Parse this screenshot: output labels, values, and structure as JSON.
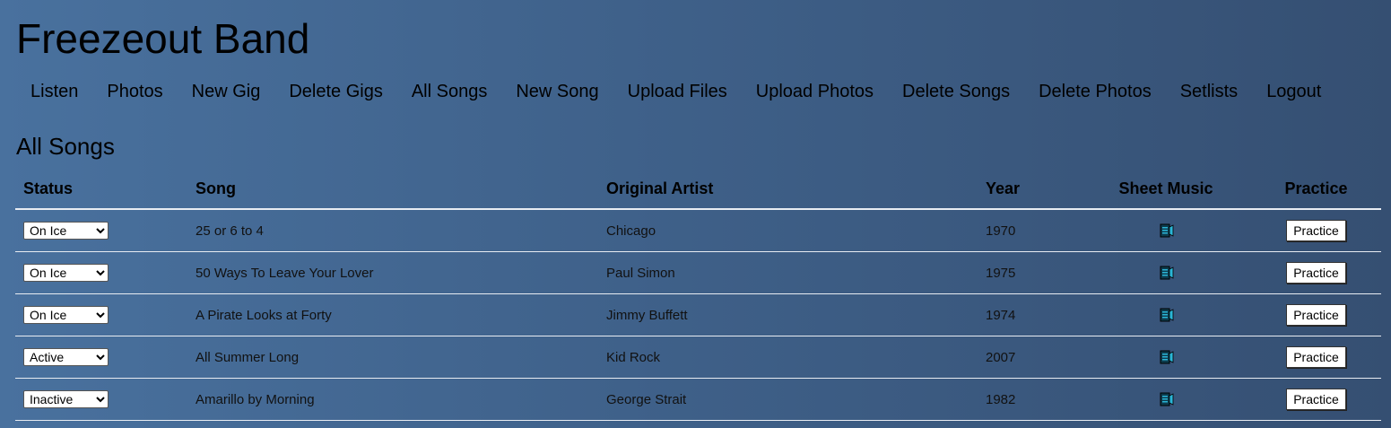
{
  "site": {
    "title": "Freezeout Band"
  },
  "nav": {
    "items": [
      {
        "label": "Listen",
        "name": "nav-listen"
      },
      {
        "label": "Photos",
        "name": "nav-photos"
      },
      {
        "label": "New Gig",
        "name": "nav-new-gig"
      },
      {
        "label": "Delete Gigs",
        "name": "nav-delete-gigs"
      },
      {
        "label": "All Songs",
        "name": "nav-all-songs"
      },
      {
        "label": "New Song",
        "name": "nav-new-song"
      },
      {
        "label": "Upload Files",
        "name": "nav-upload-files"
      },
      {
        "label": "Upload Photos",
        "name": "nav-upload-photos"
      },
      {
        "label": "Delete Songs",
        "name": "nav-delete-songs"
      },
      {
        "label": "Delete Photos",
        "name": "nav-delete-photos"
      },
      {
        "label": "Setlists",
        "name": "nav-setlists"
      },
      {
        "label": "Logout",
        "name": "nav-logout"
      }
    ]
  },
  "page": {
    "heading": "All Songs"
  },
  "table": {
    "headers": {
      "status": "Status",
      "song": "Song",
      "artist": "Original Artist",
      "year": "Year",
      "sheet_music": "Sheet Music",
      "practice": "Practice"
    },
    "rows": [
      {
        "status": "On Ice",
        "song": "25 or 6 to 4",
        "artist": "Chicago",
        "year": "1970",
        "sheet_icon": "sheet-music-icon",
        "practice_label": "Practice"
      },
      {
        "status": "On Ice",
        "song": "50 Ways To Leave Your Lover",
        "artist": "Paul Simon",
        "year": "1975",
        "sheet_icon": "sheet-music-icon",
        "practice_label": "Practice"
      },
      {
        "status": "On Ice",
        "song": "A Pirate Looks at Forty",
        "artist": "Jimmy Buffett",
        "year": "1974",
        "sheet_icon": "sheet-music-icon",
        "practice_label": "Practice"
      },
      {
        "status": "Active",
        "song": "All Summer Long",
        "artist": "Kid Rock",
        "year": "2007",
        "sheet_icon": "sheet-music-icon",
        "practice_label": "Practice"
      },
      {
        "status": "Inactive",
        "song": "Amarillo by Morning",
        "artist": "George Strait",
        "year": "1982",
        "sheet_icon": "sheet-music-icon",
        "practice_label": "Practice"
      }
    ]
  },
  "colors": {
    "background_light": "#49719e",
    "background_dark": "#354f72",
    "divider": "#e8ecf2",
    "icon_accent": "#2ab6d6"
  }
}
